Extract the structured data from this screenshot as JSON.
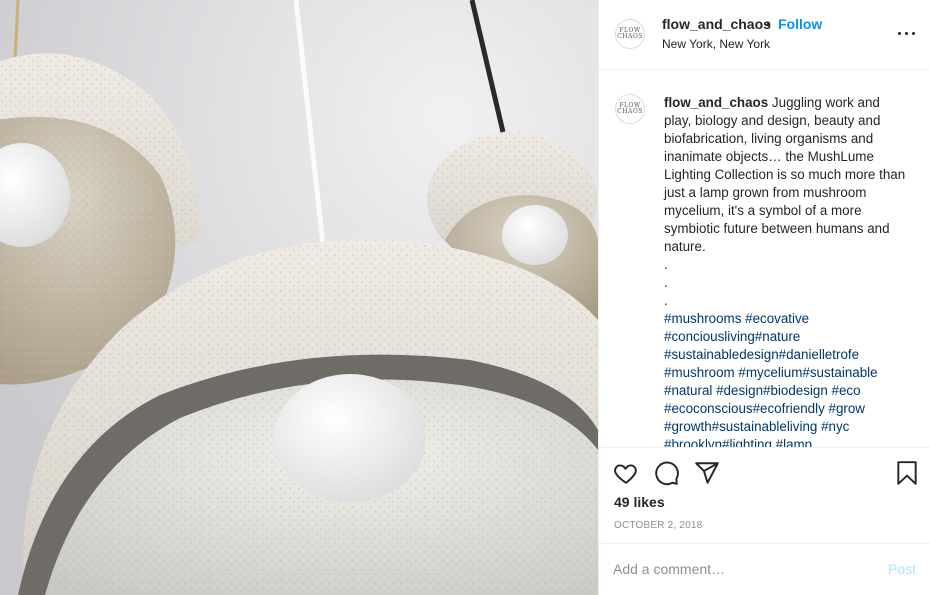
{
  "post": {
    "username": "flow_and_chaos",
    "avatar_text": "FLOW\nCHAOS",
    "separator": "•",
    "follow_label": "Follow",
    "location": "New York, New York",
    "more_icon": "more-options-icon"
  },
  "caption": {
    "username": "flow_and_chaos",
    "text": "Juggling work and play, biology and design, beauty and biofabrication, living organisms and inanimate objects… the MushLume Lighting Collection is so much more than just a lamp grown from mushroom mycelium, it's a symbol of a more symbiotic future between humans and nature.",
    "dots": [
      ".",
      ".",
      "."
    ],
    "hashtags": [
      "#mushrooms #ecovative",
      "#conciousliving#nature",
      "#sustainabledesign#danielletrofe",
      "#mushroom #mycelium#sustainable",
      "#natural #design#biodesign #eco",
      "#ecoconscious#ecofriendly #grow",
      "#growth#sustainableliving #nyc",
      "#brooklyn#lighting #lamp"
    ]
  },
  "actions": {
    "icons": [
      "heart-icon",
      "comment-icon",
      "share-icon",
      "bookmark-icon"
    ]
  },
  "likes": "49 likes",
  "date": "OCTOBER 2, 2018",
  "comment": {
    "placeholder": "Add a comment…",
    "post_label": "Post"
  },
  "colors": {
    "link_blue": "#0095f6",
    "hashtag": "#00376b",
    "post_disabled": "#b2dffc",
    "muted": "#8e8e8e"
  }
}
